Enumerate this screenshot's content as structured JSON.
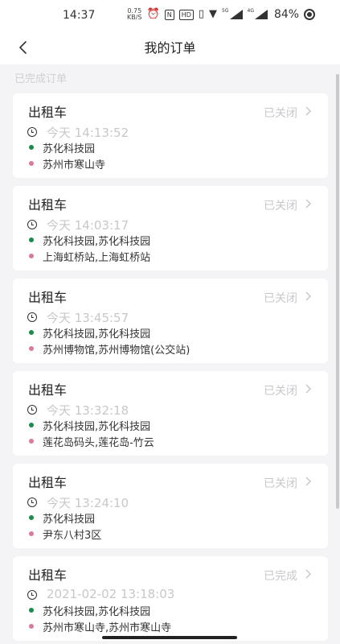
{
  "status_bar": {
    "time": "14:37",
    "net_speed_value": "0.75",
    "net_speed_unit": "KB/S",
    "nfc_label": "N",
    "hd_label": "HD",
    "sim1_tag": "5G",
    "sim2_tag": "4G",
    "battery": "84%"
  },
  "nav": {
    "title": "我的订单"
  },
  "section_label": "已完成订单",
  "orders": [
    {
      "title": "出租车",
      "status": "已关闭",
      "time": "今天 14:13:52",
      "start": "苏化科技园",
      "end": "苏州市寒山寺"
    },
    {
      "title": "出租车",
      "status": "已关闭",
      "time": "今天 14:03:17",
      "start": "苏化科技园,苏化科技园",
      "end": "上海虹桥站,上海虹桥站"
    },
    {
      "title": "出租车",
      "status": "已关闭",
      "time": "今天 13:45:57",
      "start": "苏化科技园,苏化科技园",
      "end": "苏州博物馆,苏州博物馆(公交站)"
    },
    {
      "title": "出租车",
      "status": "已关闭",
      "time": "今天 13:32:18",
      "start": "苏化科技园,苏化科技园",
      "end": "莲花岛码头,莲花岛-竹云"
    },
    {
      "title": "出租车",
      "status": "已关闭",
      "time": "今天 13:24:10",
      "start": "苏化科技园",
      "end": "尹东八村3区"
    },
    {
      "title": "出租车",
      "status": "已完成",
      "time": "2021-02-02 13:18:03",
      "start": "苏化科技园,苏化科技园",
      "end": "苏州市寒山寺,苏州市寒山寺"
    }
  ],
  "colors": {
    "start_dot": "#1c8a4a",
    "end_dot": "#d97a9a",
    "muted_text": "#c8c8cc"
  }
}
